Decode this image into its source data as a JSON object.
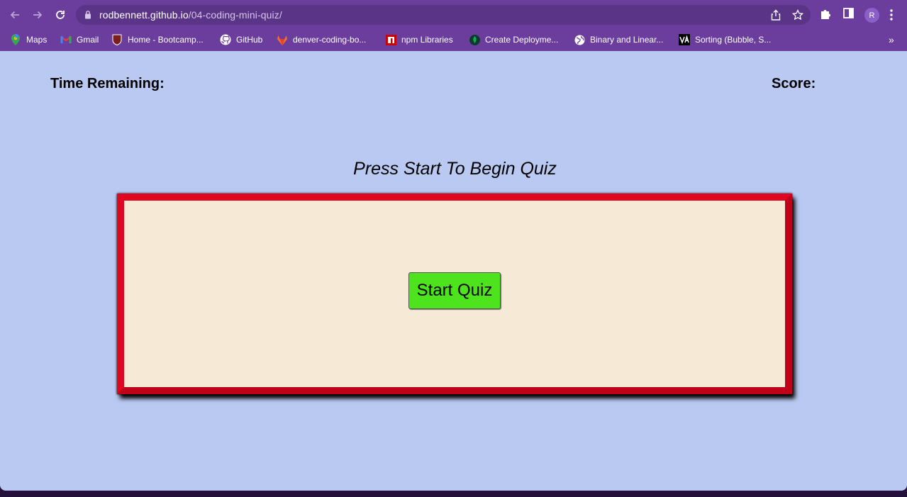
{
  "browser": {
    "url_host": "rodbennett.github.io",
    "url_path": "/04-coding-mini-quiz/",
    "profile_initial": "R",
    "bookmarks": [
      {
        "label": "Maps",
        "icon": "maps-icon"
      },
      {
        "label": "Gmail",
        "icon": "gmail-icon"
      },
      {
        "label": "Home - Bootcamp...",
        "icon": "bootcamp-icon"
      },
      {
        "label": "GitHub",
        "icon": "github-icon"
      },
      {
        "label": "denver-coding-bo...",
        "icon": "gitlab-icon"
      },
      {
        "label": "npm Libraries",
        "icon": "npm-icon"
      },
      {
        "label": "Create Deployme...",
        "icon": "mongodb-icon"
      },
      {
        "label": "Binary and Linear...",
        "icon": "globe-icon"
      },
      {
        "label": "Sorting (Bubble, S...",
        "icon": "visualgo-icon"
      }
    ],
    "more_bookmarks": "»"
  },
  "quiz": {
    "time_label": "Time Remaining:",
    "score_label": "Score:",
    "prompt": "Press Start To Begin Quiz",
    "start_button": "Start Quiz"
  },
  "colors": {
    "chrome": "#6b3e9e",
    "page_bg": "#b9c9f2",
    "box_border": "#d0021b",
    "box_fill": "#f6ead6",
    "start_button": "#4de41d"
  }
}
